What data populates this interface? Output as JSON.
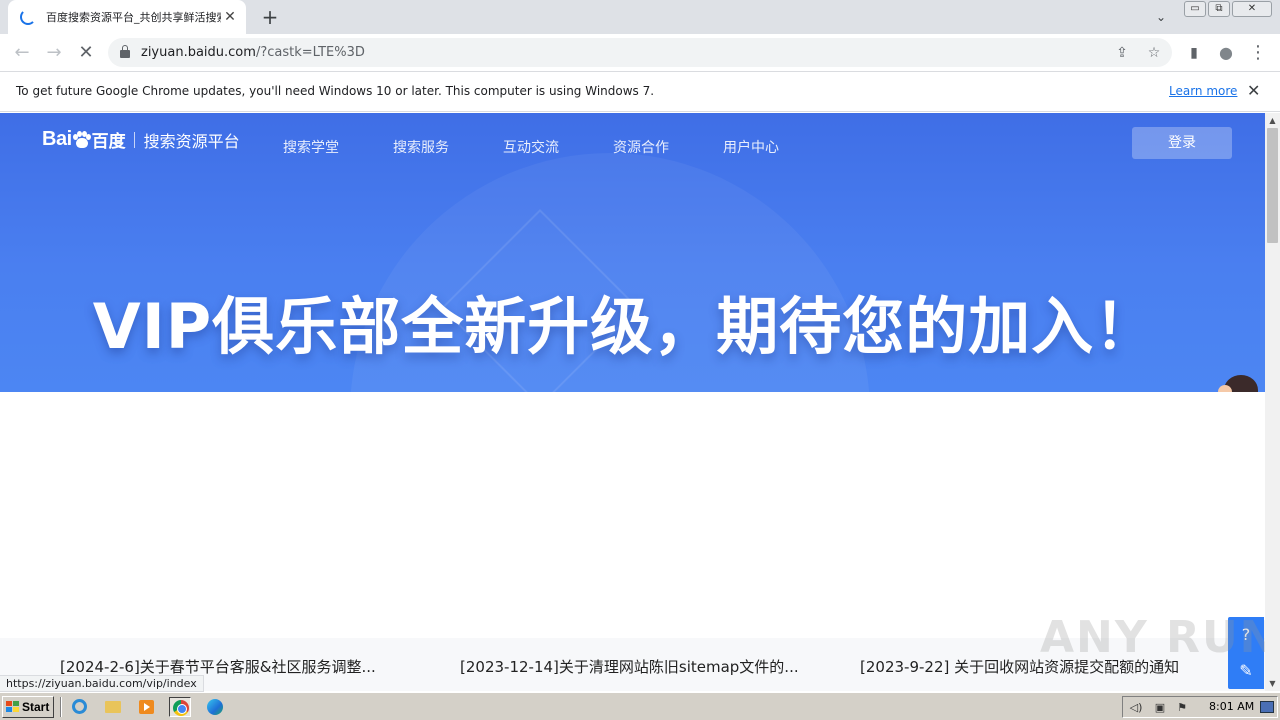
{
  "browser": {
    "tab": {
      "title": "百度搜索资源平台_共创共享鲜活搜索",
      "close": "✕"
    },
    "new_tab": "+",
    "tab_search": "⌄",
    "window_controls": {
      "minimize": "▭",
      "restore": "⧉",
      "close": "✕"
    },
    "nav": {
      "back": "←",
      "forward": "→",
      "stop": "✕"
    },
    "address": {
      "host": "ziyuan.baidu.com",
      "path": "/?castk=LTE%3D"
    },
    "omnibox_icons": {
      "share": "⇪",
      "bookmark": "☆"
    },
    "toolbar_icons": {
      "sidebar": "▮",
      "profile": "●",
      "menu": "⋮"
    },
    "infobar": {
      "message": "To get future Google Chrome updates, you'll need Windows 10 or later. This computer is using Windows 7.",
      "link": "Learn more",
      "close": "✕"
    },
    "status_url": "https://ziyuan.baidu.com/vip/index"
  },
  "site": {
    "logo": {
      "bai": "Bai",
      "du_mark": "du",
      "baidu_cn": "百度",
      "platform": "搜索资源平台"
    },
    "nav": [
      "搜索学堂",
      "搜索服务",
      "互动交流",
      "资源合作",
      "用户中心"
    ],
    "login": "登录",
    "banner": "VIP俱乐部全新升级，期待您的加入！",
    "notices": [
      "[2024-2-6]关于春节平台客服&社区服务调整...",
      "[2023-12-14]关于清理网站陈旧sitemap文件的...",
      "[2023-9-22] 关于回收网站资源提交配额的通知"
    ],
    "float_tools": {
      "help": "?",
      "feedback": "✎"
    },
    "watermark": "ANY RUN"
  },
  "taskbar": {
    "start": "Start",
    "apps": [
      "internet-explorer",
      "file-explorer",
      "media-player",
      "chrome",
      "edge"
    ],
    "tray_icons": {
      "volume": "◁)",
      "network": "▣",
      "flag": "⚑"
    },
    "clock": "8:01 AM"
  },
  "colors": {
    "hero_blue": "#4a7ff0",
    "float_tools_blue": "#2f7df6",
    "link_blue": "#1a73e8"
  }
}
